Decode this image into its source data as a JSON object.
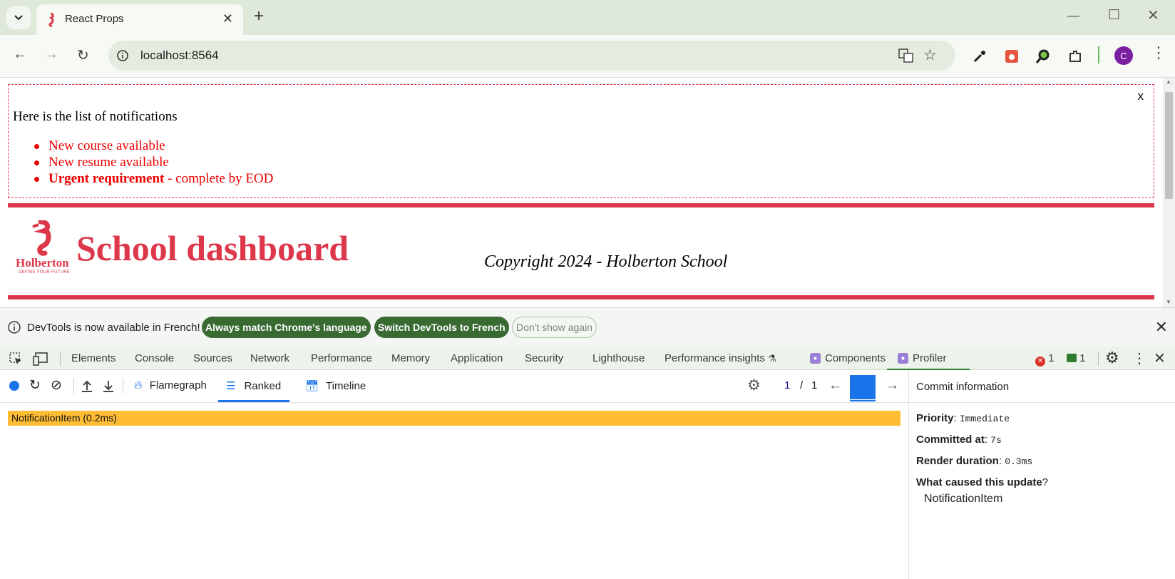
{
  "browser": {
    "tab_title": "React Props",
    "url": "localhost:8564",
    "profile_initial": "C"
  },
  "page": {
    "notifications": {
      "close_label": "x",
      "heading": "Here is the list of notifications",
      "items": [
        {
          "text": "New course available"
        },
        {
          "text": "New resume available"
        },
        {
          "strong": "Urgent requirement",
          "text": " - complete by EOD"
        }
      ]
    },
    "header": {
      "logo_text": "Holberton",
      "logo_tagline": "DEFINE YOUR FUTURE",
      "title": "School dashboard"
    },
    "footer": {
      "copyright": "Copyright 2024 - Holberton School"
    },
    "brand_color": "#dd374b"
  },
  "devtools": {
    "infobar": {
      "message": "DevTools is now available in French!",
      "btn_match": "Always match Chrome's language",
      "btn_switch": "Switch DevTools to French",
      "btn_dismiss": "Don't show again"
    },
    "tabs": [
      "Elements",
      "Console",
      "Sources",
      "Network",
      "Performance",
      "Memory",
      "Application",
      "Security",
      "Lighthouse",
      "Performance insights",
      "Components",
      "Profiler"
    ],
    "active_tab": "Profiler",
    "error_count": "1",
    "message_count": "1",
    "profiler": {
      "views": {
        "flamegraph": "Flamegraph",
        "ranked": "Ranked",
        "timeline": "Timeline"
      },
      "active_view": "Ranked",
      "commit_index": "1",
      "commit_sep": "/",
      "commit_total": "1",
      "ranked_items": [
        {
          "label": "NotificationItem (0.2ms)",
          "color": "#ffbd36"
        }
      ]
    },
    "commit_info": {
      "title": "Commit information",
      "priority_label": "Priority",
      "priority_value": "Immediate",
      "committed_label": "Committed at",
      "committed_value": "7s",
      "duration_label": "Render duration",
      "duration_value": "0.3ms",
      "cause_label": "What caused this update",
      "cause_item": "NotificationItem"
    }
  }
}
